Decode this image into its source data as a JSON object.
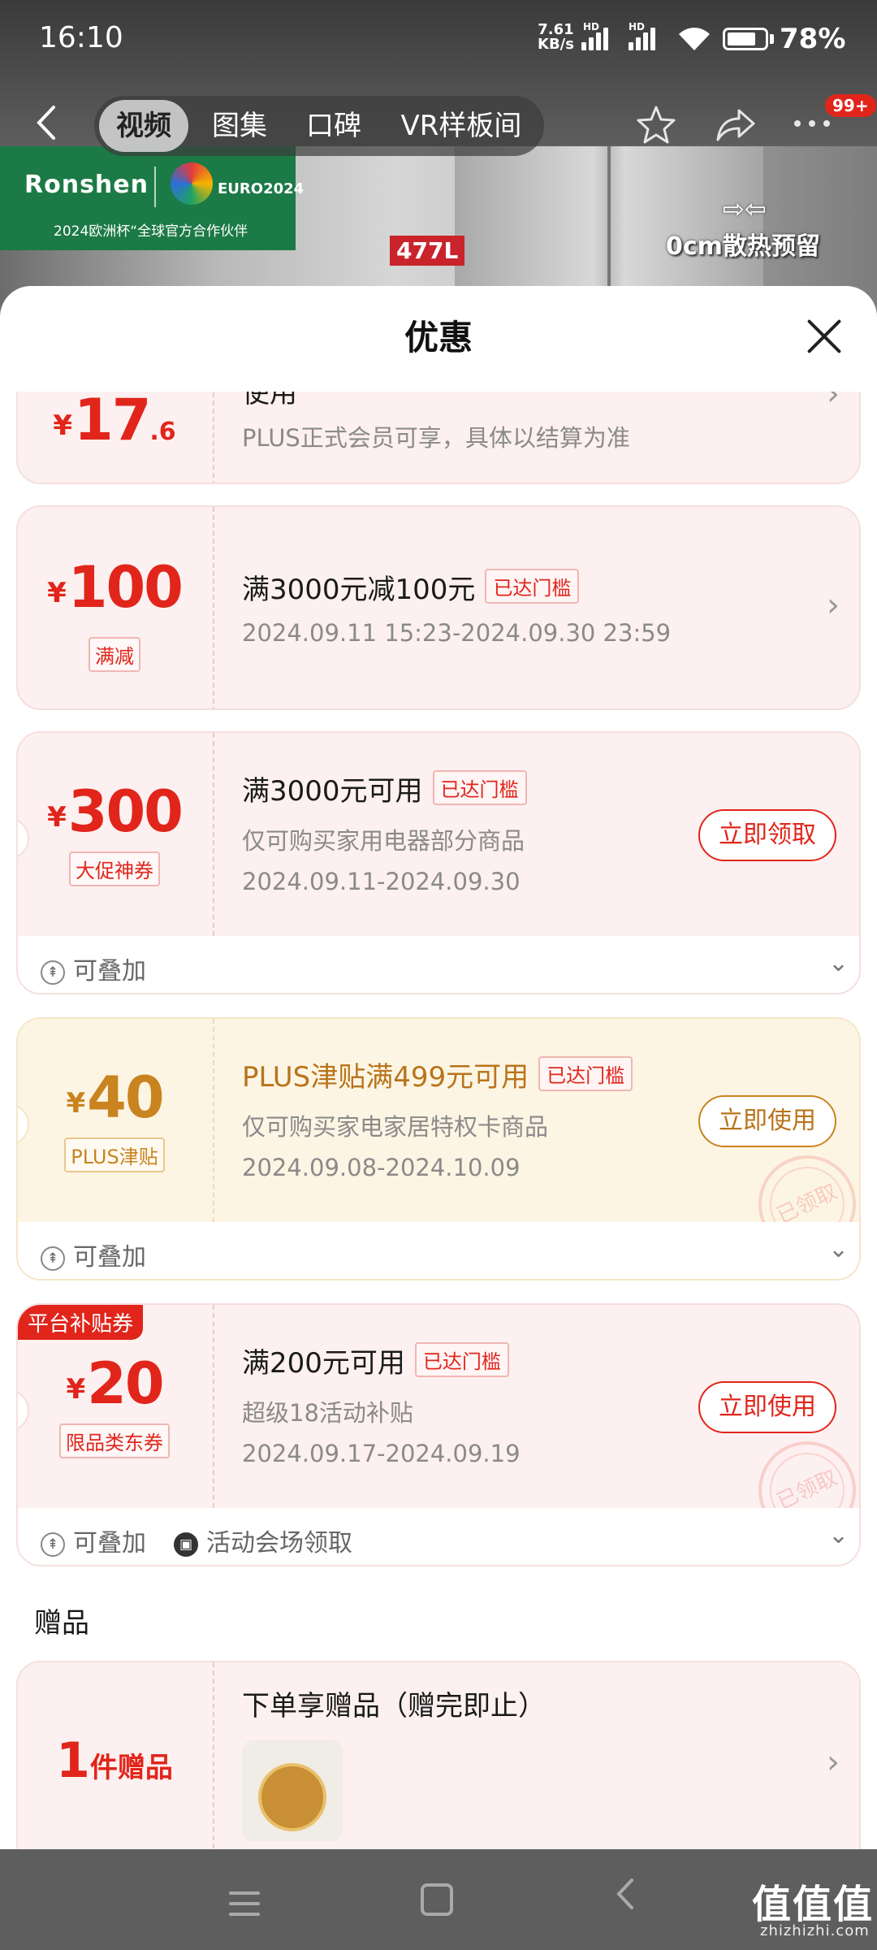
{
  "status_bar": {
    "time": "16:10",
    "net_speed_value": "7.61",
    "net_speed_unit": "KB/s",
    "hd1": "HD",
    "hd2": "HD",
    "wifi_label": "6",
    "battery_percent": "78%",
    "battery_level": 0.78
  },
  "backdrop": {
    "brand": "Ronshen",
    "euro_badge": "EURO2024",
    "partner_tag": "2024欧洲杯“全球官方合作伙伴",
    "volume": "477L",
    "heat_note": "0cm散热预留"
  },
  "navbar": {
    "tabs": [
      "视频",
      "图集",
      "口碑",
      "VR样板间"
    ],
    "active_tab": 0,
    "badge": "99+",
    "icons": [
      "back-icon",
      "star-icon",
      "share-icon",
      "more-icon"
    ]
  },
  "sheet": {
    "title": "优惠",
    "coupons": [
      {
        "currency": "¥",
        "amount": "17",
        "decimal": ".6",
        "title_tail": "使用",
        "line1": "PLUS正式会员可享，具体以结算为准"
      },
      {
        "currency": "¥",
        "amount": "100",
        "tag": "满减",
        "title": "满3000元减100元",
        "badge": "已达门槛",
        "line1": "2024.09.11 15:23-2024.09.30 23:59"
      },
      {
        "currency": "¥",
        "amount": "300",
        "tag": "大促神券",
        "title": "满3000元可用",
        "badge": "已达门槛",
        "line1": "仅可购买家用电器部分商品",
        "line2": "2024.09.11-2024.09.30",
        "button": "立即领取",
        "foot": [
          "可叠加"
        ]
      },
      {
        "currency": "¥",
        "amount": "40",
        "tag": "PLUS津贴",
        "title": "PLUS津贴满499元可用",
        "badge": "已达门槛",
        "line1": "仅可购买家电家居特权卡商品",
        "line2": "2024.09.08-2024.10.09",
        "button": "立即使用",
        "stamp": "已领取",
        "foot": [
          "可叠加"
        ]
      },
      {
        "corner": "平台补贴券",
        "currency": "¥",
        "amount": "20",
        "tag": "限品类东券",
        "title": "满200元可用",
        "badge": "已达门槛",
        "line1": "超级18活动补贴",
        "line2": "2024.09.17-2024.09.19",
        "button": "立即使用",
        "stamp": "已领取",
        "foot": [
          "可叠加",
          "活动会场领取"
        ]
      }
    ],
    "gift_section_title": "赠品",
    "gift": {
      "count": "1",
      "unit": "件赠品",
      "title": "下单享赠品（赠完即止）"
    }
  },
  "watermark": {
    "main": "值值值",
    "sub": "zhizhizhi.com"
  },
  "colors": {
    "accent_red": "#e1251b",
    "gold": "#c9841f",
    "coupon_bg": "#fdf0f0",
    "gold_bg": "#fdf5e4"
  }
}
